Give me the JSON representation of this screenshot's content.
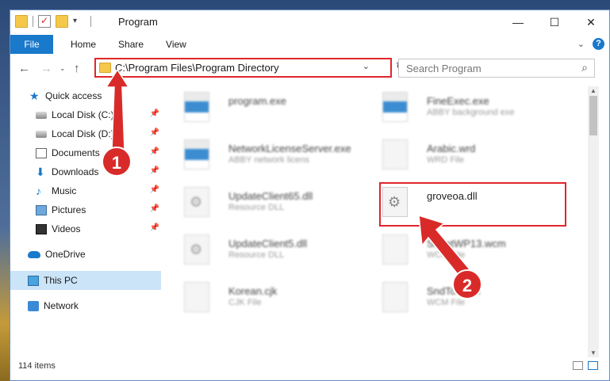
{
  "window": {
    "title": "Program",
    "buttons": {
      "minimize": "—",
      "maximize": "☐",
      "close": "✕"
    }
  },
  "ribbon": {
    "tabs": [
      {
        "label": "File",
        "active": true
      },
      {
        "label": "Home"
      },
      {
        "label": "Share"
      },
      {
        "label": "View"
      }
    ],
    "collapse_icon": "chevron-down-icon",
    "help_label": "?"
  },
  "address": {
    "path": "C:\\Program Files\\Program Directory",
    "search_placeholder": "Search Program"
  },
  "sidebar": {
    "items": [
      {
        "label": "Quick access",
        "icon": "star-icon"
      },
      {
        "label": "Local Disk (C:)",
        "icon": "disk-icon",
        "pinned": true
      },
      {
        "label": "Local Disk (D:)",
        "icon": "disk-icon",
        "pinned": true
      },
      {
        "label": "Documents",
        "icon": "documents-icon",
        "pinned": true
      },
      {
        "label": "Downloads",
        "icon": "downloads-icon",
        "pinned": true
      },
      {
        "label": "Music",
        "icon": "music-icon",
        "pinned": true
      },
      {
        "label": "Pictures",
        "icon": "pictures-icon",
        "pinned": true
      },
      {
        "label": "Videos",
        "icon": "videos-icon",
        "pinned": true
      },
      {
        "label": "OneDrive",
        "icon": "onedrive-icon"
      },
      {
        "label": "This PC",
        "icon": "this-pc-icon",
        "selected": true
      },
      {
        "label": "Network",
        "icon": "network-icon"
      }
    ]
  },
  "files": [
    {
      "name": "program.exe",
      "desc": "",
      "icon": "app-icon"
    },
    {
      "name": "FineExec.exe",
      "desc": "ABBY background exe",
      "icon": "app-icon"
    },
    {
      "name": "NetworkLicenseServer.exe",
      "desc": "ABBY network licens",
      "icon": "app-icon"
    },
    {
      "name": "Arabic.wrd",
      "desc": "WRD File",
      "icon": "file-icon"
    },
    {
      "name": "UpdateClient65.dll",
      "desc": "Resource DLL",
      "icon": "gear-icon"
    },
    {
      "name": "groveoa.dll",
      "desc": "",
      "icon": "gear-icon"
    },
    {
      "name": "UpdateClient5.dll",
      "desc": "Resource DLL",
      "icon": "gear-icon"
    },
    {
      "name": "SheetWP13.wcm",
      "desc": "WCM File",
      "icon": "file-icon"
    },
    {
      "name": "Korean.cjk",
      "desc": "CJK File",
      "icon": "file-icon"
    },
    {
      "name": "SndTo.wcm",
      "desc": "WCM File",
      "icon": "file-icon"
    }
  ],
  "status": {
    "item_count": "114 items"
  },
  "steps": {
    "one": "1",
    "two": "2"
  },
  "colors": {
    "accent": "#1979ca",
    "highlight": "#e0262a"
  }
}
